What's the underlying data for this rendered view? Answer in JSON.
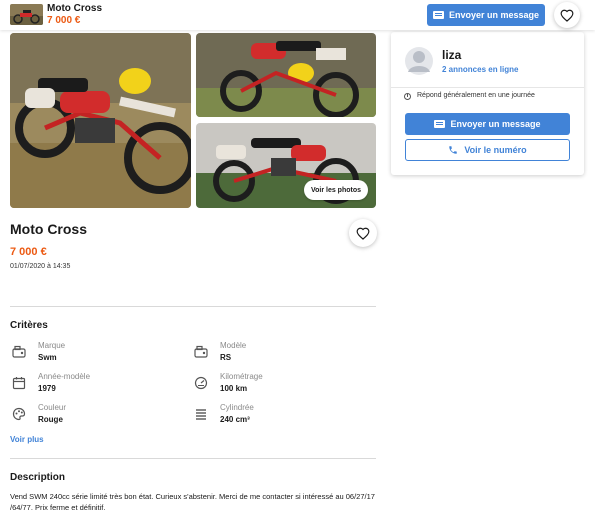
{
  "header": {
    "title": "Moto Cross",
    "price": "7 000 €",
    "message_button": "Envoyer un message"
  },
  "gallery": {
    "see_photos_label": "Voir les photos"
  },
  "seller": {
    "name": "liza",
    "ads_link": "2 annonces en ligne",
    "reply_time": "Répond généralement en une journée",
    "message_button": "Envoyer un message",
    "phone_button": "Voir le numéro"
  },
  "listing": {
    "title": "Moto Cross",
    "price": "7 000 €",
    "date": "01/07/2020 à 14:35"
  },
  "criteria": {
    "title": "Critères",
    "items": [
      {
        "label": "Marque",
        "value": "Swm",
        "icon": "tag-icon"
      },
      {
        "label": "Modèle",
        "value": "RS",
        "icon": "tag-icon"
      },
      {
        "label": "Année-modèle",
        "value": "1979",
        "icon": "calendar-icon"
      },
      {
        "label": "Kilométrage",
        "value": "100 km",
        "icon": "speedometer-icon"
      },
      {
        "label": "Couleur",
        "value": "Rouge",
        "icon": "palette-icon"
      },
      {
        "label": "Cylindrée",
        "value": "240 cm³",
        "icon": "engine-icon"
      }
    ],
    "more_link": "Voir plus"
  },
  "description": {
    "title": "Description",
    "text": "Vend SWM 240cc série limité très bon état. Curieux s'abstenir. Merci de me contacter si intéressé au 06/27/17 /64/77. Prix ferme et définitif."
  },
  "colors": {
    "accent": "#4183d7",
    "price": "#ec5a13"
  }
}
